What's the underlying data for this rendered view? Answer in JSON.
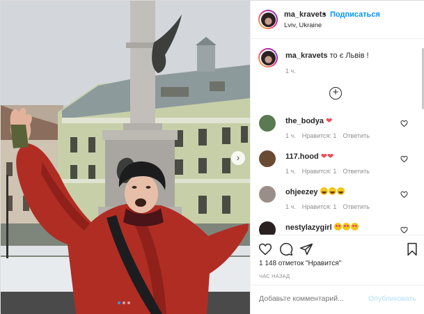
{
  "post": {
    "username": "ma_kravets",
    "follow_separator": "•",
    "follow_label": "Подписаться",
    "location": "Lviv, Ukraine",
    "caption_text": "то є Львів !",
    "caption_time": "1 ч."
  },
  "comments": [
    {
      "user": "the_bodya",
      "emoji": "hearts-1",
      "time": "1 ч.",
      "likes": "Нравится: 1",
      "reply": "Ответить",
      "avatar_color": "#5a7a52"
    },
    {
      "user": "117.hood",
      "emoji": "hearts-2",
      "time": "1 ч.",
      "likes": "Нравится: 1",
      "reply": "Ответить",
      "avatar_color": "#6b4a33"
    },
    {
      "user": "ohjeezey",
      "emoji": "laugh-3",
      "time": "1 ч.",
      "likes": "Нравится: 1",
      "reply": "Ответить",
      "avatar_color": "#9a8f88"
    },
    {
      "user": "nestylazygirl",
      "emoji": "love-3",
      "time": "",
      "likes": "",
      "reply": "",
      "avatar_color": "#2b2020"
    }
  ],
  "actions": {
    "likes_text": "1 148 отметок \"Нравится\"",
    "time_ago": "ЧАС НАЗАД"
  },
  "add_comment": {
    "placeholder": "Добавьте комментарий...",
    "publish_label": "Опубликовать"
  },
  "colors": {
    "link": "#0095f6",
    "heart": "#ed4956",
    "publish_disabled": "#b2dffc"
  },
  "carousel": {
    "slides": 3,
    "active_index": 0
  }
}
